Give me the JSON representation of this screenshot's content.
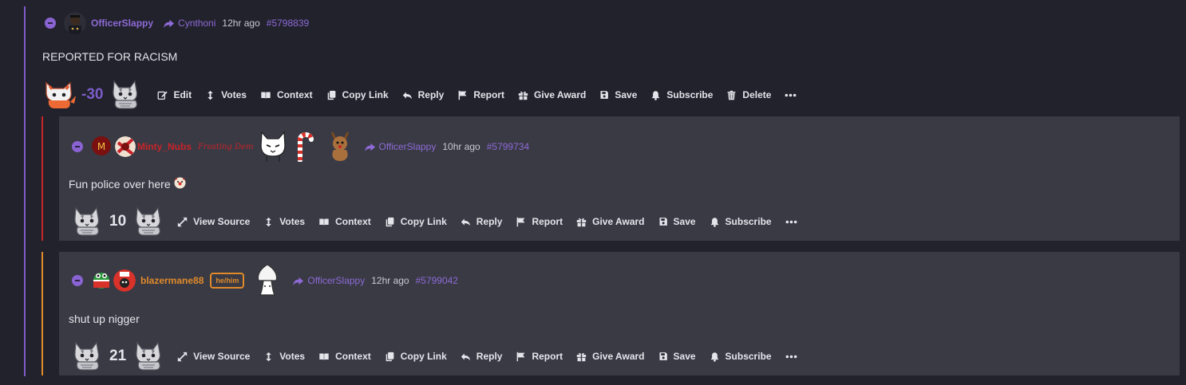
{
  "comments": [
    {
      "username": "OfficerSlappy",
      "replying_to": "Cynthoni",
      "time": "12hr ago",
      "id": "#5798839",
      "body": "REPORTED FOR RACISM",
      "score": "-30",
      "actions": [
        "Edit",
        "Votes",
        "Context",
        "Copy Link",
        "Reply",
        "Report",
        "Give Award",
        "Save",
        "Subscribe",
        "Delete"
      ]
    },
    {
      "username": "Minty_Nubs",
      "flair": "Frosting Dem",
      "replying_to": "OfficerSlappy",
      "time": "10hr ago",
      "id": "#5799734",
      "body": "Fun police over here",
      "score": "10",
      "actions": [
        "View Source",
        "Votes",
        "Context",
        "Copy Link",
        "Reply",
        "Report",
        "Give Award",
        "Save",
        "Subscribe"
      ]
    },
    {
      "username": "blazermane88",
      "pronouns": "he/him",
      "replying_to": "OfficerSlappy",
      "time": "12hr ago",
      "id": "#5799042",
      "body": "shut up nigger",
      "score": "21",
      "actions": [
        "View Source",
        "Votes",
        "Context",
        "Copy Link",
        "Reply",
        "Report",
        "Give Award",
        "Save",
        "Subscribe"
      ]
    }
  ],
  "colors": {
    "accent": "#8e6ad6",
    "downvote": "#7c5cc8",
    "red_thread": "#c8242a",
    "orange_thread": "#e08a2a"
  },
  "icons": [
    "collapse-icon",
    "reply-arrow-icon",
    "edit-icon",
    "votes-icon",
    "context-icon",
    "copy-link-icon",
    "reply-icon",
    "report-icon",
    "award-icon",
    "save-icon",
    "subscribe-icon",
    "delete-icon",
    "more-icon",
    "expand-icon"
  ]
}
